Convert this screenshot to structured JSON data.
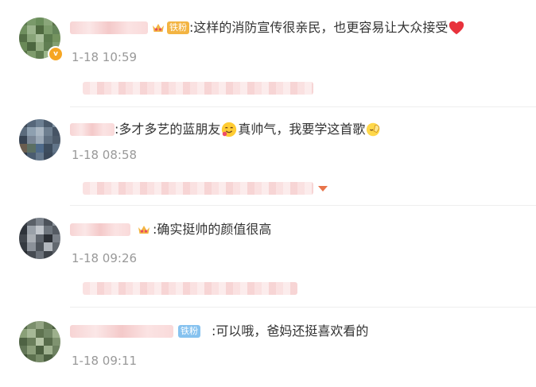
{
  "comments": [
    {
      "text": ":这样的消防宣传很亲民，也更容易让大众接受",
      "badge": "铁粉",
      "time": "1-18 10:59",
      "verified_icon": "verified-v-icon",
      "trailing_emoji": "red-heart-icon"
    },
    {
      "text_a": ":多才多艺的蓝朋友",
      "text_b": "真帅气，我要学这首歌",
      "time": "1-18 08:58",
      "emoji_1": "drooling-face-icon",
      "emoji_2": "applause-hands-icon"
    },
    {
      "text": ":确实挺帅的颜值很高",
      "time": "1-18 09:26",
      "crown_icon": "crown-icon"
    },
    {
      "text": ":可以哦，爸妈还挺喜欢看的",
      "badge": "铁粉",
      "time": "1-18 09:11"
    }
  ],
  "colors": {
    "timestamp": "#999999",
    "text": "#333333",
    "badge_gold": "#f3b442",
    "badge_blue": "#86c2ef",
    "heart": "#e8323c"
  }
}
